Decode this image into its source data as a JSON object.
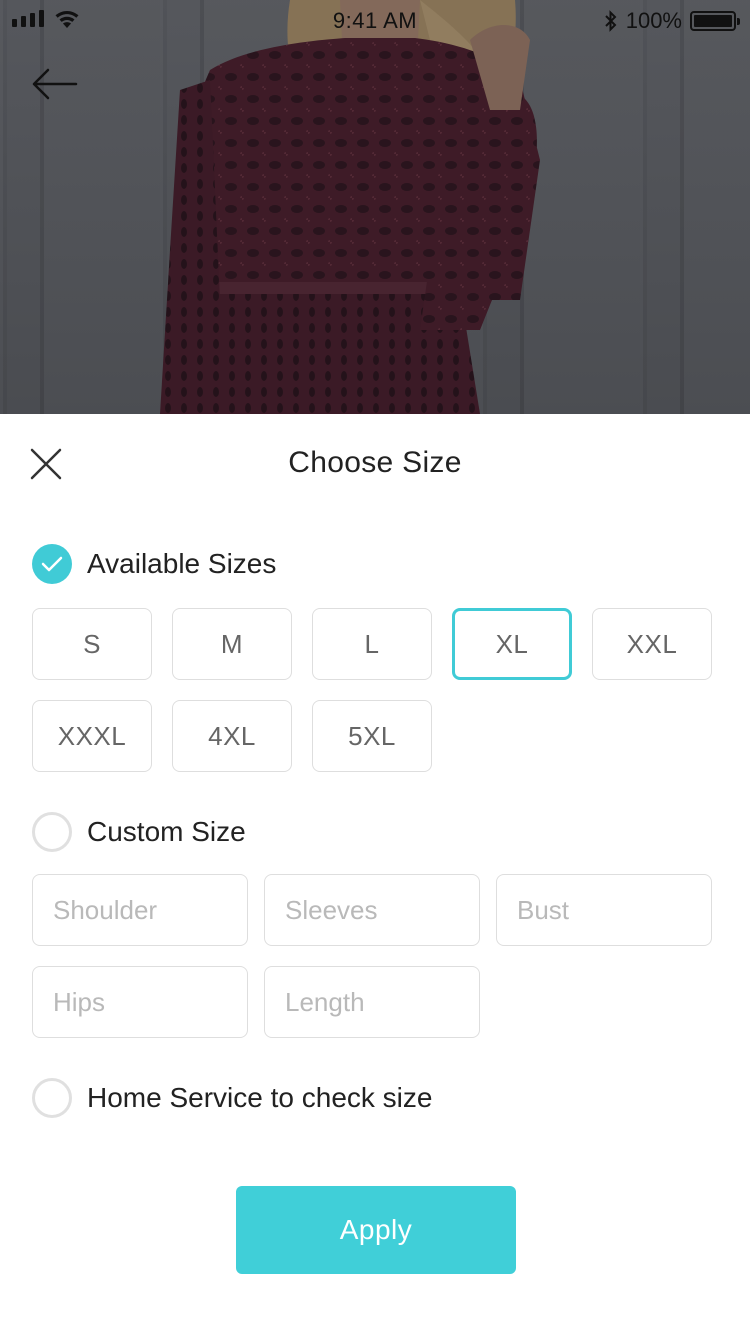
{
  "status_bar": {
    "time": "9:41 AM",
    "battery": "100%"
  },
  "icons": {
    "back": "arrow-left-icon",
    "close": "close-icon",
    "check": "checkmark-icon",
    "bluetooth": "bluetooth-icon",
    "wifi": "wifi-icon",
    "signal": "signal-icon",
    "battery": "battery-icon"
  },
  "colors": {
    "accent": "#40cbd6",
    "hero_garment": "#4a1524"
  },
  "sheet": {
    "title": "Choose Size"
  },
  "options": {
    "available": {
      "label": "Available Sizes",
      "checked": true
    },
    "custom": {
      "label": "Custom Size",
      "checked": false
    },
    "home": {
      "label": "Home Service to check size",
      "checked": false
    }
  },
  "sizes": [
    "S",
    "M",
    "L",
    "XL",
    "XXL",
    "XXXL",
    "4XL",
    "5XL"
  ],
  "selected_size": "XL",
  "custom_fields": {
    "shoulder": {
      "placeholder": "Shoulder",
      "value": ""
    },
    "sleeves": {
      "placeholder": "Sleeves",
      "value": ""
    },
    "bust": {
      "placeholder": "Bust",
      "value": ""
    },
    "hips": {
      "placeholder": "Hips",
      "value": ""
    },
    "length": {
      "placeholder": "Length",
      "value": ""
    }
  },
  "apply_label": "Apply"
}
